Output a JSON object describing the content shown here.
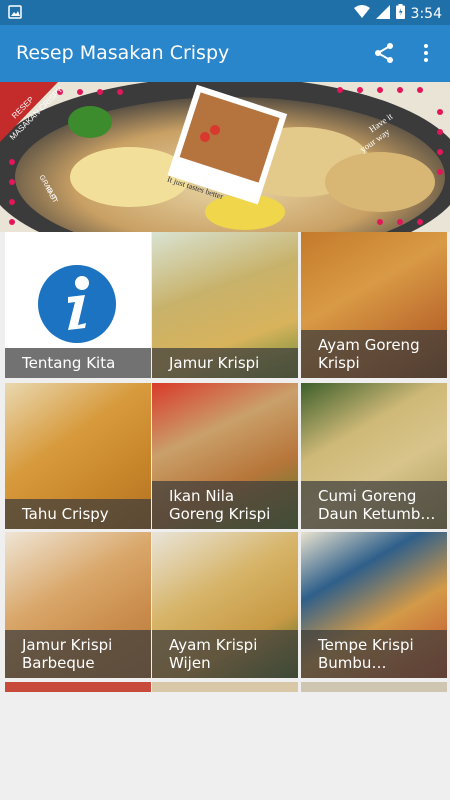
{
  "status_bar": {
    "time": "3:54",
    "icons": [
      "image-icon",
      "wifi-icon",
      "signal-icon",
      "battery-icon"
    ],
    "color": "#1f6fa9"
  },
  "app_bar": {
    "title": "Resep Masakan Crispy",
    "actions": [
      "share-icon",
      "more-vert-icon"
    ],
    "color": "#2a86cb"
  },
  "banner": {
    "ribbon_text": "RESEP\nMASAKAN CRISPY",
    "left_text": "GRAB IT\nFAST",
    "photo_caption": "It just tastes better",
    "right_text": "Have it\nyour way"
  },
  "menu": {
    "items": [
      {
        "label": "Tentang Kita",
        "icon": "info-icon"
      },
      {
        "label": "Jamur Krispi"
      },
      {
        "label": "Ayam Goreng\nKrispi"
      },
      {
        "label": "Tahu Crispy"
      },
      {
        "label": "Ikan Nila\nGoreng Krispi"
      },
      {
        "label": "Cumi Goreng\nDaun Ketumb…"
      },
      {
        "label": "Jamur Krispi\nBarbeque"
      },
      {
        "label": "Ayam Krispi\nWijen"
      },
      {
        "label": "Tempe Krispi\nBumbu…"
      }
    ]
  }
}
